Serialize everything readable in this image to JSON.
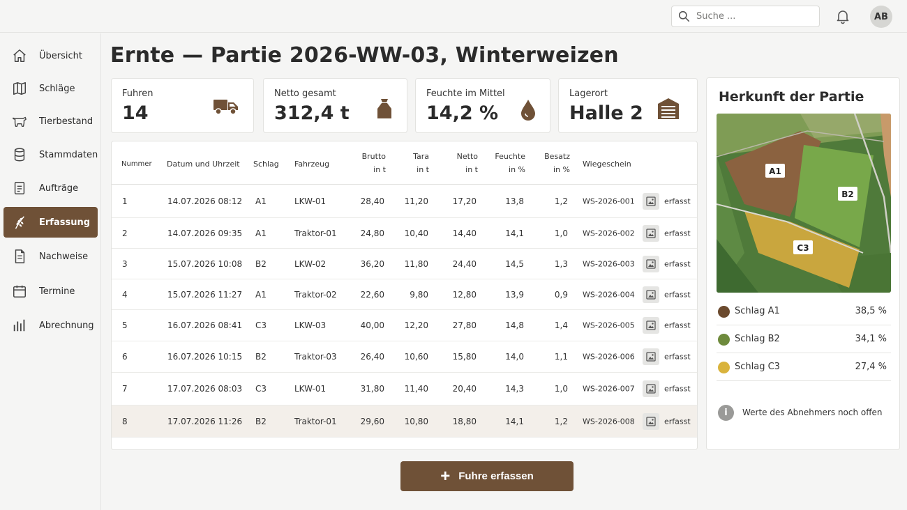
{
  "header": {
    "search": {
      "placeholder": "Suche ..."
    },
    "avatar_initials": "AB"
  },
  "sidebar": {
    "items": [
      {
        "label": "Übersicht",
        "icon": "home-icon",
        "active": false
      },
      {
        "label": "Schläge",
        "icon": "map-icon",
        "active": false
      },
      {
        "label": "Tierbestand",
        "icon": "cow-icon",
        "active": false
      },
      {
        "label": "Stammdaten",
        "icon": "database-icon",
        "active": false
      },
      {
        "label": "Aufträge",
        "icon": "clipboard-icon",
        "active": false
      },
      {
        "label": "Erfassung",
        "icon": "wheat-icon",
        "active": true
      },
      {
        "label": "Nachweise",
        "icon": "document-icon",
        "active": false
      },
      {
        "label": "Termine",
        "icon": "calendar-icon",
        "active": false
      },
      {
        "label": "Abrechnung",
        "icon": "bar-chart-icon",
        "active": false
      }
    ]
  },
  "page": {
    "title": "Ernte — Partie 2026-WW-03, Winterweizen"
  },
  "stats": [
    {
      "label": "Fuhren",
      "value": "14",
      "icon": "truck-icon"
    },
    {
      "label": "Netto gesamt",
      "value": "312,4 t",
      "icon": "grain-sack-icon"
    },
    {
      "label": "Feuchte im Mittel",
      "value": "14,2 %",
      "icon": "droplet-icon"
    },
    {
      "label": "Lagerort",
      "value": "Halle 2",
      "icon": "storage-hall-icon"
    }
  ],
  "table": {
    "headers": {
      "nummer": "Nummer",
      "datum": "Datum und Uhrzeit",
      "schlag": "Schlag",
      "fahrzeug": "Fahrzeug",
      "brutto_1": "Brutto",
      "brutto_2": "in t",
      "tara_1": "Tara",
      "tara_2": "in t",
      "netto_1": "Netto",
      "netto_2": "in t",
      "feuchte_1": "Feuchte",
      "feuchte_2": "in %",
      "besatz_1": "Besatz",
      "besatz_2": "in %",
      "wiegeschein": "Wiegeschein"
    },
    "rows": [
      {
        "nr": "1",
        "datum": "14.07.2026  08:12",
        "schlag": "A1",
        "fahrzeug": "LKW-01",
        "brutto": "28,40",
        "tara": "11,20",
        "netto": "17,20",
        "feuchte": "13,8",
        "besatz": "1,2",
        "schein": "WS-2026-001",
        "status": "erfasst"
      },
      {
        "nr": "2",
        "datum": "14.07.2026  09:35",
        "schlag": "A1",
        "fahrzeug": "Traktor-01",
        "brutto": "24,80",
        "tara": "10,40",
        "netto": "14,40",
        "feuchte": "14,1",
        "besatz": "1,0",
        "schein": "WS-2026-002",
        "status": "erfasst"
      },
      {
        "nr": "3",
        "datum": "15.07.2026  10:08",
        "schlag": "B2",
        "fahrzeug": "LKW-02",
        "brutto": "36,20",
        "tara": "11,80",
        "netto": "24,40",
        "feuchte": "14,5",
        "besatz": "1,3",
        "schein": "WS-2026-003",
        "status": "erfasst"
      },
      {
        "nr": "4",
        "datum": "15.07.2026  11:27",
        "schlag": "A1",
        "fahrzeug": "Traktor-02",
        "brutto": "22,60",
        "tara": "9,80",
        "netto": "12,80",
        "feuchte": "13,9",
        "besatz": "0,9",
        "schein": "WS-2026-004",
        "status": "erfasst"
      },
      {
        "nr": "5",
        "datum": "16.07.2026  08:41",
        "schlag": "C3",
        "fahrzeug": "LKW-03",
        "brutto": "40,00",
        "tara": "12,20",
        "netto": "27,80",
        "feuchte": "14,8",
        "besatz": "1,4",
        "schein": "WS-2026-005",
        "status": "erfasst"
      },
      {
        "nr": "6",
        "datum": "16.07.2026  10:15",
        "schlag": "B2",
        "fahrzeug": "Traktor-03",
        "brutto": "26,40",
        "tara": "10,60",
        "netto": "15,80",
        "feuchte": "14,0",
        "besatz": "1,1",
        "schein": "WS-2026-006",
        "status": "erfasst"
      },
      {
        "nr": "7",
        "datum": "17.07.2026  08:03",
        "schlag": "C3",
        "fahrzeug": "LKW-01",
        "brutto": "31,80",
        "tara": "11,40",
        "netto": "20,40",
        "feuchte": "14,3",
        "besatz": "1,0",
        "schein": "WS-2026-007",
        "status": "erfasst"
      },
      {
        "nr": "8",
        "datum": "17.07.2026  11:26",
        "schlag": "B2",
        "fahrzeug": "Traktor-01",
        "brutto": "29,60",
        "tara": "10,80",
        "netto": "18,80",
        "feuchte": "14,1",
        "besatz": "1,2",
        "schein": "WS-2026-008",
        "status": "erfasst"
      }
    ]
  },
  "origin": {
    "title": "Herkunft der Partie",
    "map_labels": [
      "A1",
      "B2",
      "C3"
    ],
    "legend": [
      {
        "name": "Schlag A1",
        "pct": "38,5  %",
        "color": "#6b4a2e"
      },
      {
        "name": "Schlag B2",
        "pct": "34,1  %",
        "color": "#6e8a3c"
      },
      {
        "name": "Schlag C3",
        "pct": "27,4  %",
        "color": "#d9b33c"
      }
    ],
    "info": "Werte des Abnehmers noch offen"
  },
  "actions": {
    "add_label": "Fuhre erfassen"
  },
  "colors": {
    "accent": "#6f5137",
    "highlight_row": "#f3efea"
  }
}
